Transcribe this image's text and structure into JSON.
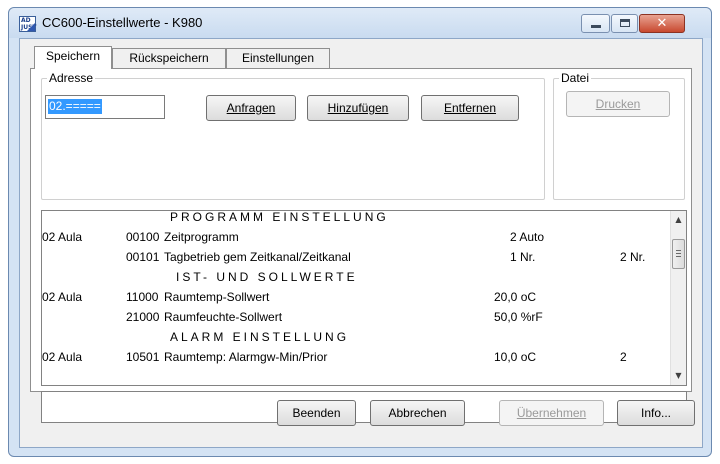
{
  "window": {
    "title": "CC600-Einstellwerte - K980",
    "icon_text": "AD JUST",
    "controls": [
      "minimize-icon",
      "maximize-icon",
      "close-icon"
    ],
    "close_glyph": "✕"
  },
  "tabs": [
    {
      "label": "Speichern",
      "active": true
    },
    {
      "label": "Rückspeichern",
      "active": false
    },
    {
      "label": "Einstellungen",
      "active": false
    }
  ],
  "address": {
    "group_label": "Adresse",
    "value": "02.=====",
    "buttons": {
      "query": "Anfragen",
      "add": "Hinzufügen",
      "remove": "Entfernen"
    }
  },
  "file": {
    "group_label": "Datei",
    "print": "Drucken"
  },
  "list": {
    "rows": [
      {
        "type": "header",
        "text": "PROGRAMM EINSTELLUNG"
      },
      {
        "type": "item",
        "room": "02 Aula",
        "code": "00100",
        "name": "Zeitprogramm",
        "value": "2 Auto",
        "extra": ""
      },
      {
        "type": "item",
        "room": "",
        "code": "00101",
        "name": "Tagbetrieb gem Zeitkanal/Zeitkanal",
        "value": "1 Nr.",
        "extra": "2 Nr."
      },
      {
        "type": "header",
        "text": "IST- UND SOLLWERTE"
      },
      {
        "type": "item",
        "room": "02 Aula",
        "code": "11000",
        "name": "Raumtemp-Sollwert",
        "value": "20,0 oC",
        "extra": ""
      },
      {
        "type": "item",
        "room": "",
        "code": "21000",
        "name": "Raumfeuchte-Sollwert",
        "value": "50,0 %rF",
        "extra": ""
      },
      {
        "type": "header",
        "text": "ALARM EINSTELLUNG"
      },
      {
        "type": "item",
        "room": "02 Aula",
        "code": "10501",
        "name": "Raumtemp: Alarmgw-Min/Prior",
        "value": "10,0 oC",
        "extra": "2"
      }
    ],
    "scroll_up": "▲",
    "scroll_down": "▼"
  },
  "footer": {
    "buttons": {
      "end": "Beenden",
      "cancel": "Abbrechen",
      "apply": "Übernehmen",
      "info": "Info..."
    }
  },
  "colors": {
    "selection": "#3399ff",
    "close_button": "#c8492f",
    "window_frame": "#d4e3f4"
  }
}
